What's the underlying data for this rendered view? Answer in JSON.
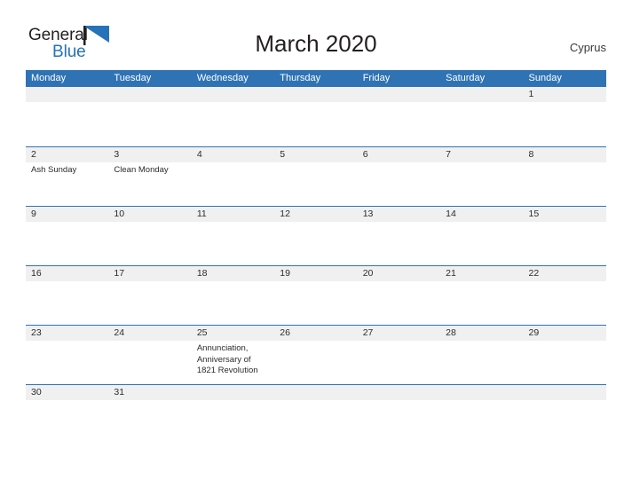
{
  "brand": {
    "name_part1": "General",
    "name_part2": "Blue",
    "flag_icon": "blue-triangle-flag-icon",
    "color_dark": "#231f20",
    "color_blue": "#2572b8"
  },
  "header": {
    "title": "March 2020",
    "region": "Cyprus"
  },
  "theme": {
    "header_bar": "#2f73b4",
    "day_band": "#f0f0f0",
    "rule": "#2f73b4",
    "text": "#2b2b2b",
    "background": "#ffffff"
  },
  "calendar": {
    "month": "March",
    "year": "2020",
    "weekday_headers": [
      "Monday",
      "Tuesday",
      "Wednesday",
      "Thursday",
      "Friday",
      "Saturday",
      "Sunday"
    ],
    "weeks": [
      [
        {
          "day": "",
          "events": []
        },
        {
          "day": "",
          "events": []
        },
        {
          "day": "",
          "events": []
        },
        {
          "day": "",
          "events": []
        },
        {
          "day": "",
          "events": []
        },
        {
          "day": "",
          "events": []
        },
        {
          "day": "1",
          "events": []
        }
      ],
      [
        {
          "day": "2",
          "events": [
            "Ash Sunday"
          ]
        },
        {
          "day": "3",
          "events": [
            "Clean Monday"
          ]
        },
        {
          "day": "4",
          "events": []
        },
        {
          "day": "5",
          "events": []
        },
        {
          "day": "6",
          "events": []
        },
        {
          "day": "7",
          "events": []
        },
        {
          "day": "8",
          "events": []
        }
      ],
      [
        {
          "day": "9",
          "events": []
        },
        {
          "day": "10",
          "events": []
        },
        {
          "day": "11",
          "events": []
        },
        {
          "day": "12",
          "events": []
        },
        {
          "day": "13",
          "events": []
        },
        {
          "day": "14",
          "events": []
        },
        {
          "day": "15",
          "events": []
        }
      ],
      [
        {
          "day": "16",
          "events": []
        },
        {
          "day": "17",
          "events": []
        },
        {
          "day": "18",
          "events": []
        },
        {
          "day": "19",
          "events": []
        },
        {
          "day": "20",
          "events": []
        },
        {
          "day": "21",
          "events": []
        },
        {
          "day": "22",
          "events": []
        }
      ],
      [
        {
          "day": "23",
          "events": []
        },
        {
          "day": "24",
          "events": []
        },
        {
          "day": "25",
          "events": [
            "Annunciation,",
            "Anniversary of",
            "1821 Revolution"
          ]
        },
        {
          "day": "26",
          "events": []
        },
        {
          "day": "27",
          "events": []
        },
        {
          "day": "28",
          "events": []
        },
        {
          "day": "29",
          "events": []
        }
      ],
      [
        {
          "day": "30",
          "events": []
        },
        {
          "day": "31",
          "events": []
        },
        {
          "day": "",
          "events": []
        },
        {
          "day": "",
          "events": []
        },
        {
          "day": "",
          "events": []
        },
        {
          "day": "",
          "events": []
        },
        {
          "day": "",
          "events": []
        }
      ]
    ]
  }
}
